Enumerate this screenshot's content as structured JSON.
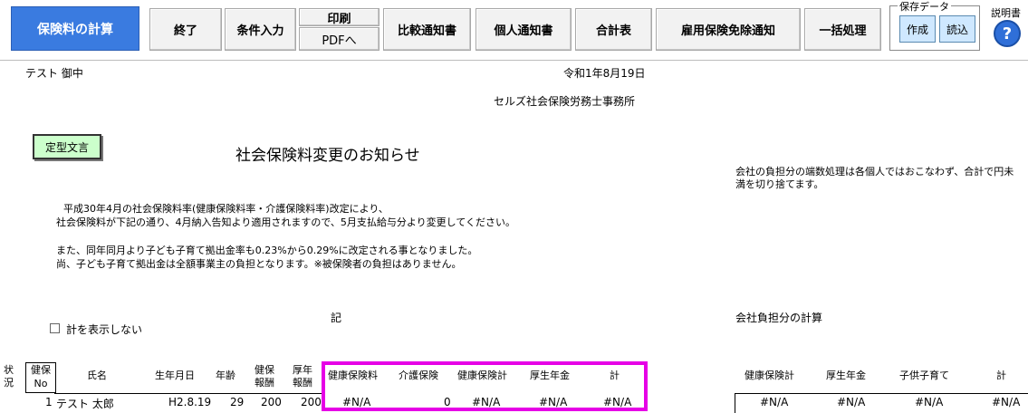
{
  "toolbar": {
    "primary": "保険料の計算",
    "end": "終了",
    "conditions": "条件入力",
    "print": "印刷",
    "pdf": "PDFへ",
    "compare": "比較通知書",
    "individual": "個人通知書",
    "summary": "合計表",
    "exemption": "雇用保険免除通知",
    "batch": "一括処理",
    "save_group_label": "保存データ",
    "save_create": "作成",
    "save_load": "読込",
    "help_label": "説明書",
    "help_icon": "?"
  },
  "letter": {
    "recipient": "テスト 御中",
    "date": "令和1年8月19日",
    "sender": "セルズ社会保険労務士事務所",
    "template_button": "定型文言",
    "title": "社会保険料変更のお知らせ",
    "side_note_1": "会社の負担分の端数処理は各個人ではおこなわず、合計で円未",
    "side_note_2": "満を切り捨てます。",
    "body_1": "平成30年4月の社会保険料率(健康保険料率・介護保険料率)改定により、",
    "body_2": "社会保険料が下記の通り、4月納入告知より適用されますので、5月支払給与分より変更してください。",
    "body_3": "また、同年同月より子ども子育て拠出金率も0.23%から0.29%に改定される事となりました。",
    "body_4": "尚、子ども子育て拠出金は全額事業主の負担となります。※被保険者の負担はありません。",
    "ki": "記",
    "company_calc": "会社負担分の計算",
    "hide_total": "計を表示しない"
  },
  "table": {
    "headers": {
      "status": "状況",
      "no_1": "健保",
      "no_2": "No",
      "name": "氏名",
      "birth": "生年月日",
      "age": "年齢",
      "kenpo_1": "健保",
      "kenpo_2": "報酬",
      "kosei_1": "厚年",
      "kosei_2": "報酬",
      "health": "健康保険料",
      "care": "介護保険",
      "health_total": "健康保険計",
      "pension": "厚生年金",
      "total": "計",
      "c_health_total": "健康保険計",
      "c_pension": "厚生年金",
      "c_child": "子供子育て",
      "c_total": "計"
    },
    "rows": [
      {
        "no": "1",
        "name": "テスト 太郎",
        "birth": "H2.8.19",
        "age": "29",
        "kenpo": "200",
        "kosei": "200",
        "health": "#N/A",
        "care": "0",
        "health_total": "#N/A",
        "pension": "#N/A",
        "total": "#N/A",
        "c_health_total": "#N/A",
        "c_pension": "#N/A",
        "c_child": "#N/A",
        "c_total": "#N/A"
      }
    ]
  }
}
